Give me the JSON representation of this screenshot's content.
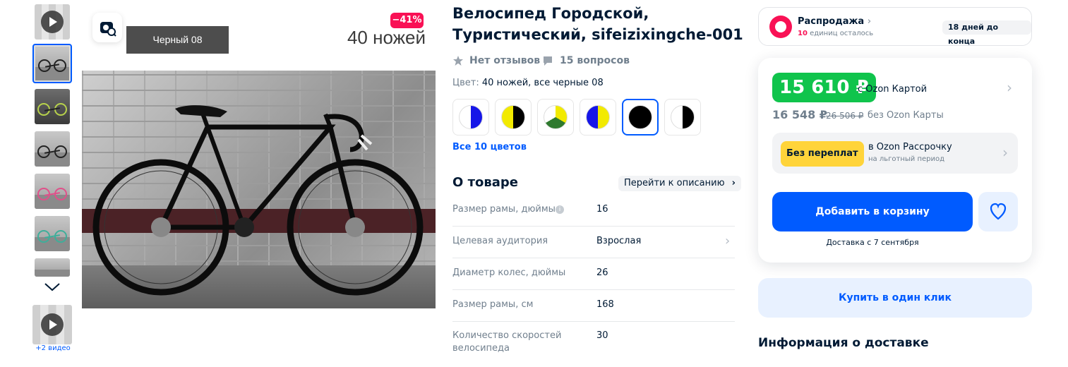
{
  "gallery": {
    "variant_label": "Черный  08",
    "discount_badge": "−41%",
    "overlay_text": "40 ножей",
    "videos_label": "+2 видео"
  },
  "product": {
    "title": "Велосипед Городской, Туристический, sifeizixingche-001",
    "reviews": "Нет отзывов",
    "questions": "15 вопросов",
    "color_label": "Цвет:",
    "color_value": "40 ножей, все черные 08",
    "all_colors": "Все 10 цветов",
    "swatches": [
      {
        "left": "#ffffff",
        "right": "#1616e8"
      },
      {
        "left": "#f2ea00",
        "right": "#000000"
      },
      {
        "left": "#ffffff",
        "right": "#2f7a2f",
        "top": "#f2ea00"
      },
      {
        "left": "#1616e8",
        "right": "#f2ea00"
      },
      {
        "left": "#000000",
        "right": "#000000",
        "selected": true
      },
      {
        "left": "#ffffff",
        "right": "#000000"
      }
    ]
  },
  "about": {
    "title": "О товаре",
    "goto_desc": "Перейти к описанию",
    "specs": [
      {
        "key": "Размер рамы, дюймы",
        "value": "16"
      },
      {
        "key": "Целевая аудитория",
        "value": "Взрослая"
      },
      {
        "key": "Диаметр колес, дюймы",
        "value": "26"
      },
      {
        "key": "Размер рамы, см",
        "value": "168"
      },
      {
        "key": "Количество скоростей велосипеда",
        "value": "30"
      }
    ]
  },
  "sale": {
    "title": "Распродажа",
    "units_count": "10",
    "units_text": " единиц осталось",
    "days_left": "18 дней до конца"
  },
  "price": {
    "card_price": "15 610 ₽",
    "card_label": "с Ozon Картой",
    "regular_price": "16 548 ₽",
    "old_price": "26 506 ₽",
    "regular_label": "без Ozon Карты",
    "no_overpay": "Без переплат",
    "installment_title": "в Ozon Рассрочку",
    "installment_sub": "на льготный период",
    "add_to_cart": "Добавить в корзину",
    "delivery_date": "Доставка с 7 сентября",
    "buy_one_click": "Купить в один клик"
  },
  "delivery": {
    "title": "Информация о доставке"
  },
  "colors": {
    "accent": "#005bff",
    "price_green": "#10c44c",
    "sale_red": "#f91155",
    "yellow": "#ffd43a"
  }
}
